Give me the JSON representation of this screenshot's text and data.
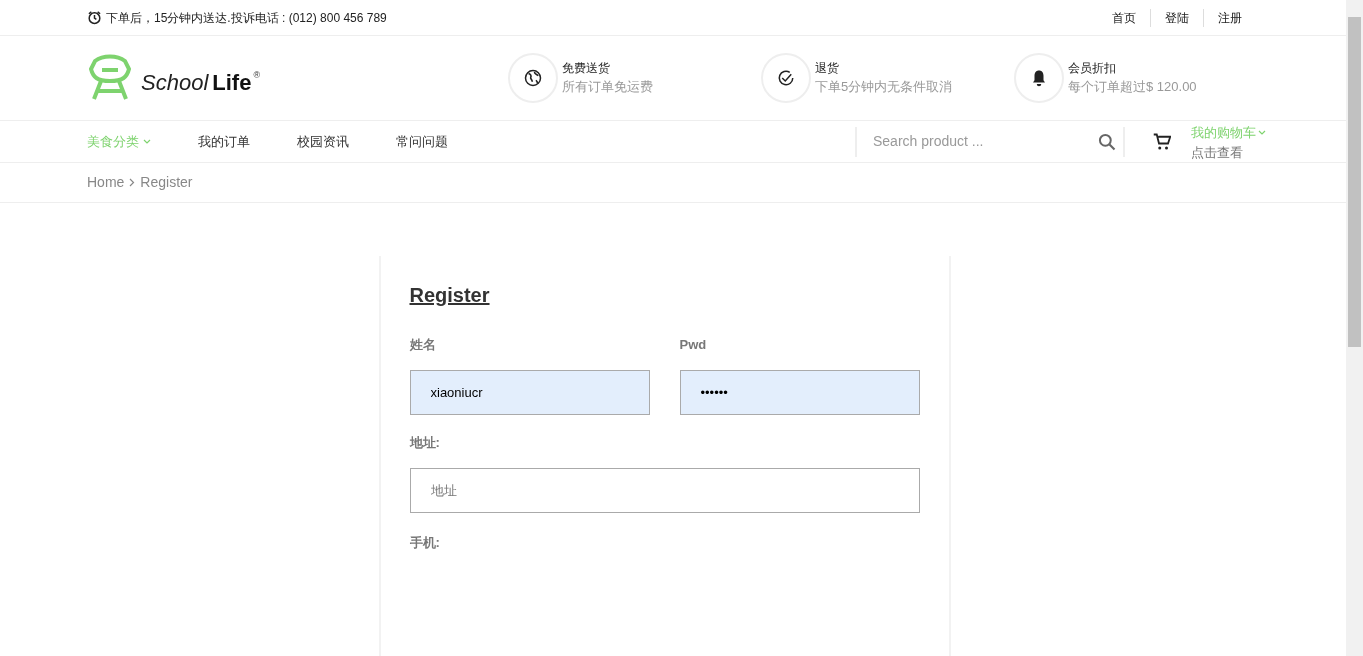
{
  "top_bar": {
    "notice": "下单后，15分钟内送达.投诉电话 : (012) 800 456 789",
    "links": [
      "首页",
      "登陆",
      "注册"
    ]
  },
  "logo": {
    "word_1": "School",
    "word_2": "Life",
    "mark": "®"
  },
  "features": [
    {
      "kind": "globe",
      "title": "免费送货",
      "subtitle": "所有订单免运费"
    },
    {
      "kind": "check",
      "title": "退货",
      "subtitle": "下单5分钟内无条件取消"
    },
    {
      "kind": "bell",
      "title": "会员折扣",
      "subtitle": "每个订单超过$ 120.00"
    }
  ],
  "nav": [
    {
      "label": "美食分类",
      "selected": true,
      "dropdown": true
    },
    {
      "label": "我的订单",
      "selected": false,
      "dropdown": false
    },
    {
      "label": "校园资讯",
      "selected": false,
      "dropdown": false
    },
    {
      "label": "常问问题",
      "selected": false,
      "dropdown": false
    }
  ],
  "search": {
    "placeholder": "Search product ..."
  },
  "cart": {
    "title": "我的购物车",
    "subtitle": "点击查看"
  },
  "breadcrumb": [
    "Home",
    "Register"
  ],
  "form": {
    "title": "Register",
    "fields": [
      {
        "label": "姓名",
        "value": "xiaoniucr",
        "autofilled": true,
        "half": true
      },
      {
        "label": "Pwd",
        "value": "••••••",
        "autofilled": true,
        "half": true
      },
      {
        "label": "地址:",
        "placeholder": "地址",
        "autofilled": false,
        "half": false
      }
    ],
    "next_label": "手机:"
  }
}
